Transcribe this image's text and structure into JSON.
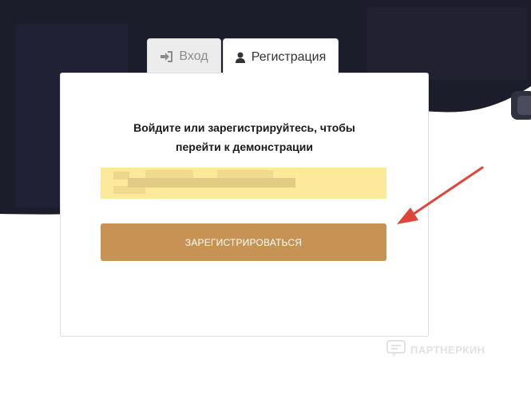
{
  "tabs": {
    "login": {
      "label": "Вход",
      "icon": "sign-in-icon"
    },
    "register": {
      "label": "Регистрация",
      "icon": "user-icon"
    }
  },
  "card": {
    "title_line1": "Войдите или зарегистрируйтесь, чтобы",
    "title_line2": "перейти к демонстрации"
  },
  "form": {
    "field_value_obscured": true,
    "submit_label": "ЗАРЕГИСТРИРОВАТЬСЯ"
  },
  "watermark": {
    "text": "ПАРТНЕРКИН"
  },
  "colors": {
    "accent": "#c79355",
    "field_bg": "#fde99b",
    "annotation_arrow": "#e0453a",
    "dark_bg": "#1c1d2b"
  }
}
